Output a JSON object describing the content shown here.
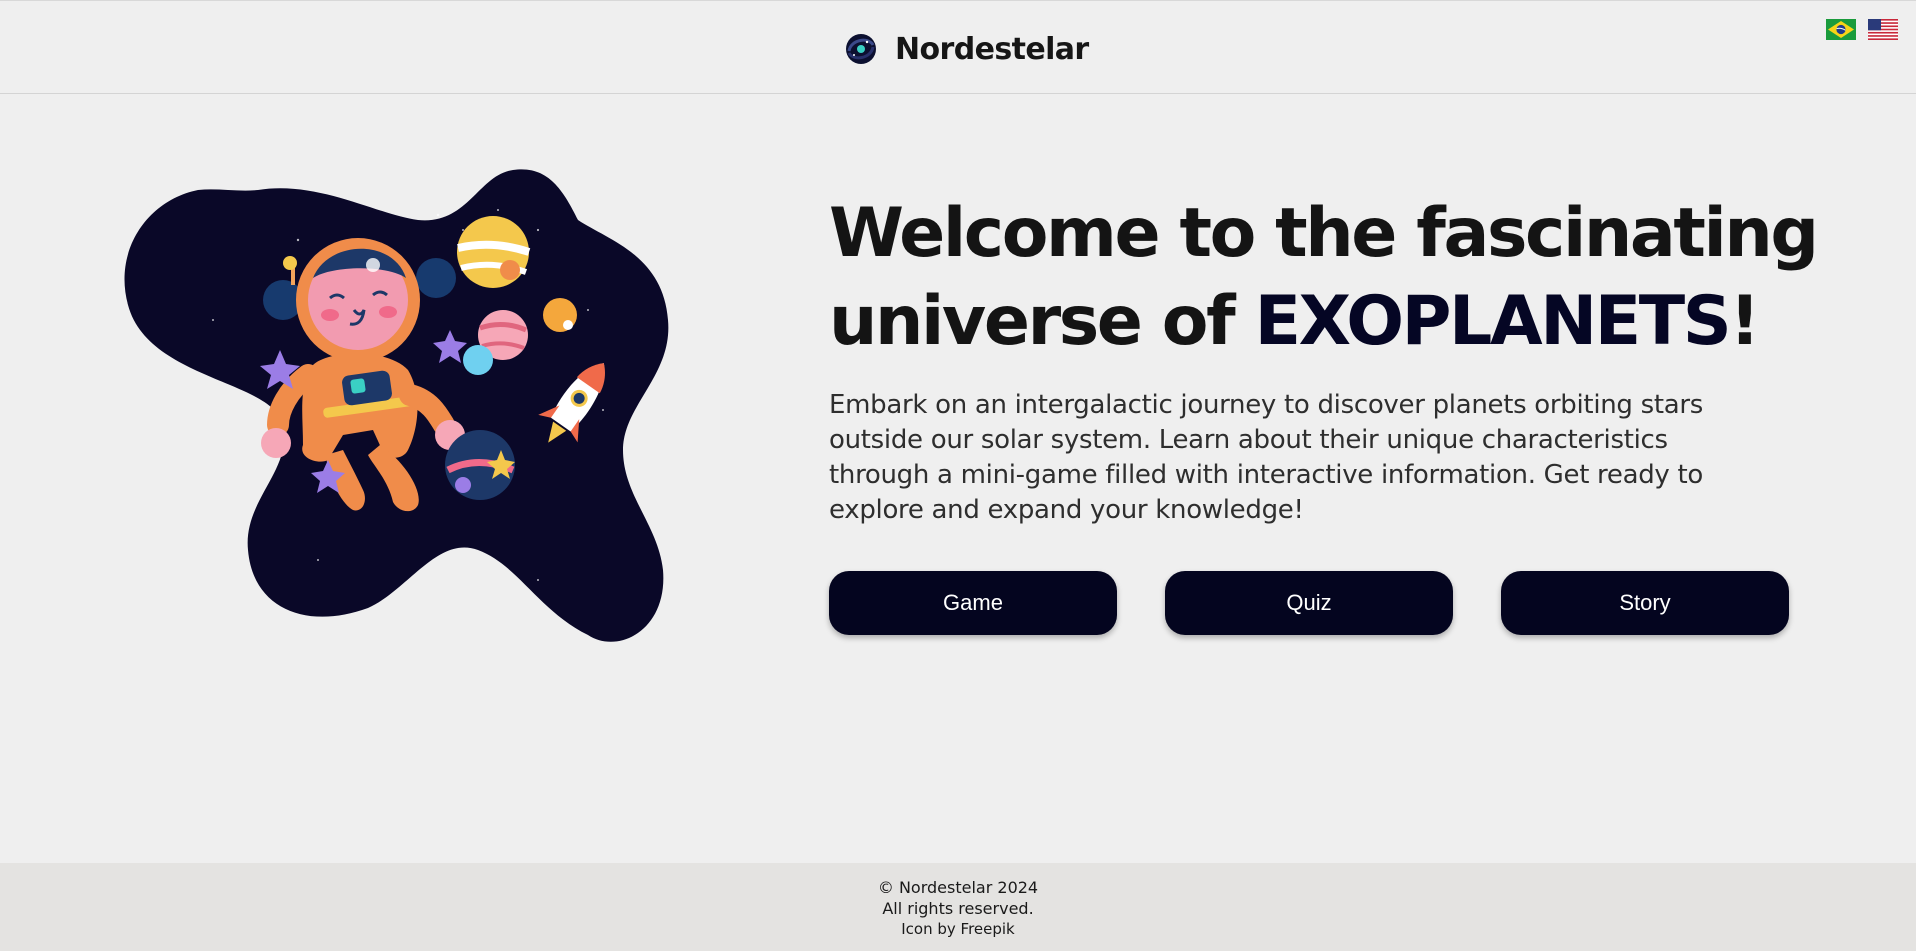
{
  "header": {
    "brand": "Nordestelar",
    "logo_icon": "galaxy-logo-icon",
    "languages": [
      {
        "code": "pt-BR",
        "icon": "brazil-flag-icon"
      },
      {
        "code": "en-US",
        "icon": "usa-flag-icon"
      }
    ]
  },
  "hero": {
    "title_part1": "Welcome to the fascinating universe of ",
    "title_highlight": "EXOPLANETS",
    "title_end": "!",
    "description": "Embark on an intergalactic journey to discover planets orbiting stars outside our solar system. Learn about their unique characteristics through a mini-game filled with interactive information. Get ready to explore and expand your knowledge!",
    "illustration_icon": "astronaut-space-illustration",
    "buttons": [
      {
        "label": "Game"
      },
      {
        "label": "Quiz"
      },
      {
        "label": "Story"
      }
    ]
  },
  "footer": {
    "copyright": "© Nordestelar 2024",
    "rights": "All rights reserved.",
    "credit": "Icon by Freepik"
  },
  "colors": {
    "background": "#efefef",
    "accent": "#050624",
    "button_bg": "#04051f",
    "footer_bg": "#e4e3e1"
  }
}
